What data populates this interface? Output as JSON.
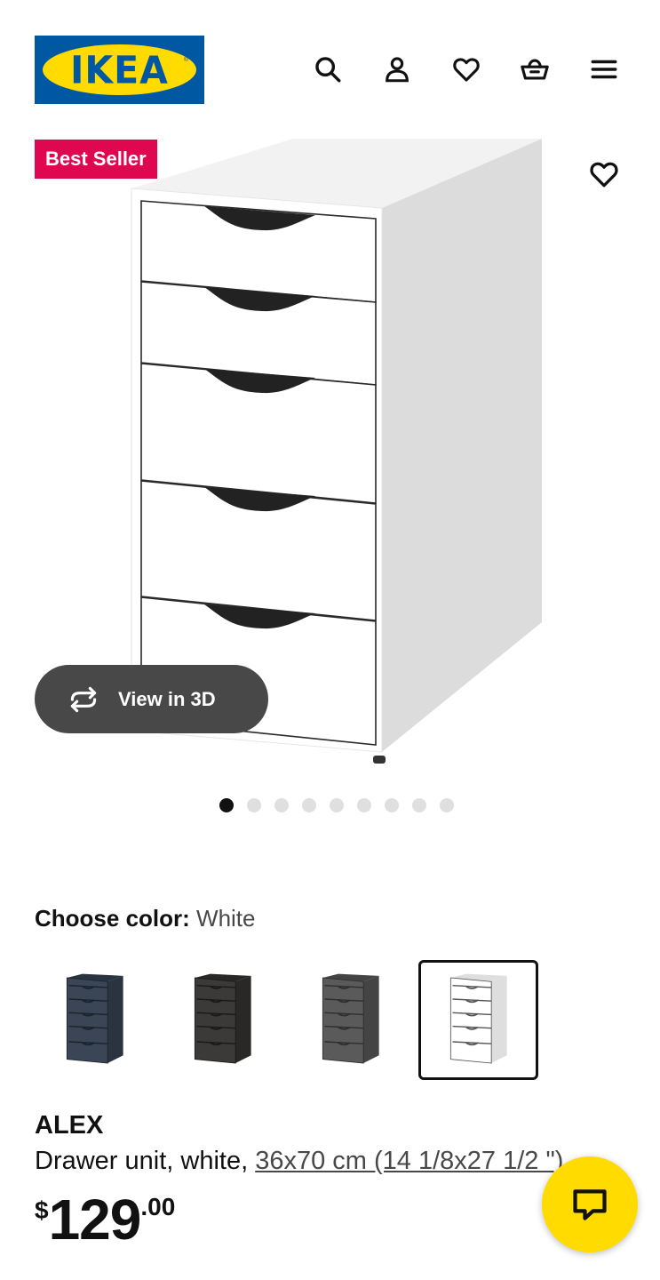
{
  "header": {
    "logo_text": "IKEA",
    "icons": [
      "search-icon",
      "account-icon",
      "wishlist-icon",
      "cart-icon",
      "menu-icon"
    ]
  },
  "gallery": {
    "badge": "Best Seller",
    "view3d_label": "View in 3D",
    "slide_count": 9,
    "active_slide": 1
  },
  "color": {
    "label": "Choose color:",
    "value": "White",
    "options": [
      {
        "name": "dark blue",
        "body": "#3a4555",
        "edge": "#2a3340",
        "line": "#1b222b"
      },
      {
        "name": "black-brown",
        "body": "#3c3a38",
        "edge": "#2a2826",
        "line": "#1a1918"
      },
      {
        "name": "gray",
        "body": "#5a5a5a",
        "edge": "#444444",
        "line": "#2e2e2e"
      },
      {
        "name": "white",
        "body": "#ffffff",
        "edge": "#dedede",
        "line": "#555555"
      }
    ],
    "selected_index": 3
  },
  "product": {
    "name": "ALEX",
    "desc": "Drawer unit, white, ",
    "size_link": "36x70 cm (14 1/8x27 1/2 \")",
    "price_currency": "$",
    "price_integer": "129",
    "price_decimal": ".00"
  },
  "colors": {
    "brand_blue": "#0058a3",
    "brand_yellow": "#ffdb00",
    "badge_red": "#e00751"
  }
}
